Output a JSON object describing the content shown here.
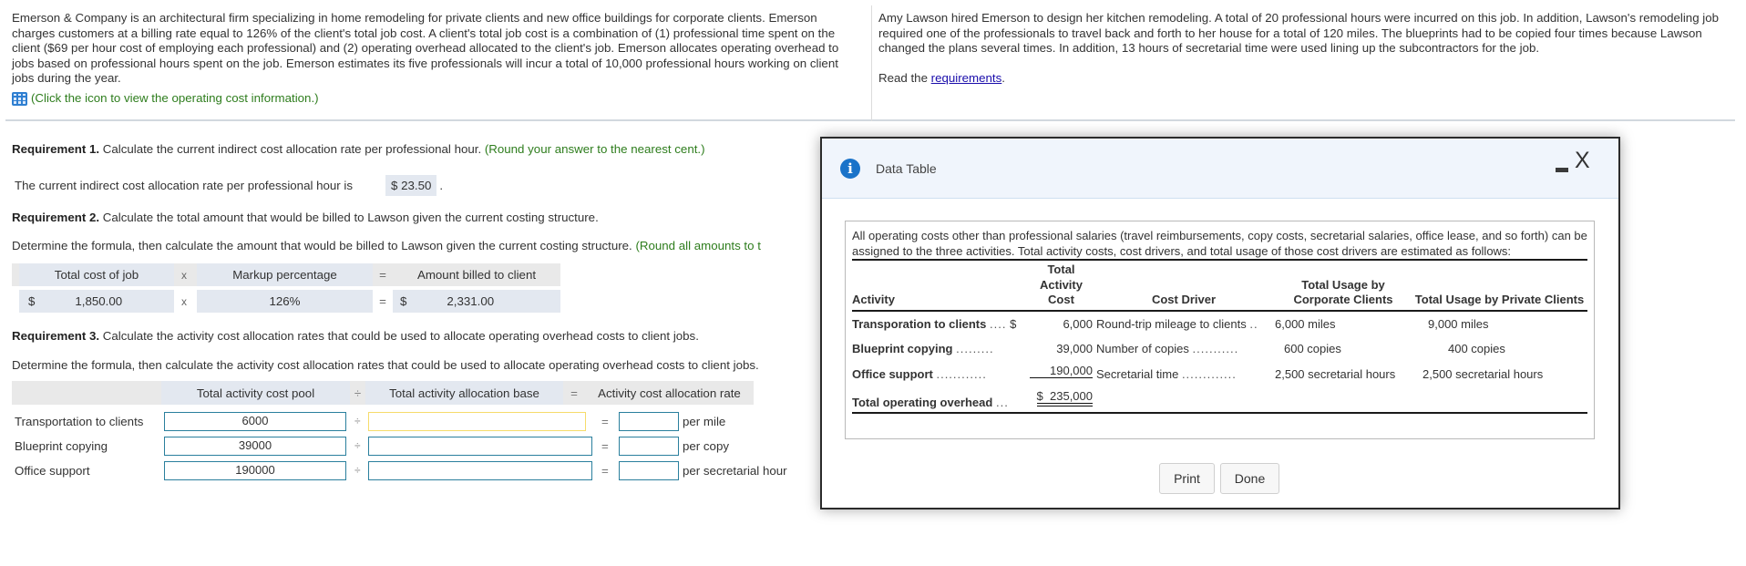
{
  "problem": {
    "intro_text": "Emerson & Company is an architectural firm specializing in home remodeling for private clients and new office buildings for corporate clients. Emerson charges customers at a billing rate equal to 126% of the client's total job cost. A client's total job cost is a combination of (1) professional time spent on the client ($69 per hour cost of employing each professional) and (2) operating overhead allocated to the client's job. Emerson allocates operating overhead to jobs based on professional hours spent on the job. Emerson estimates its five professionals will incur a total of 10,000 professional hours working on client jobs during the year.",
    "icon_link_text": "(Click the icon to view the operating cost information.)",
    "icon": "table-grid-icon",
    "lawson_text": "Amy Lawson hired Emerson to design her kitchen remodeling. A total of 20 professional hours were incurred on this job. In addition, Lawson's remodeling job required one of the professionals to travel back and forth to her house for a total of 120 miles. The blueprints had to be copied four times because Lawson changed the plans several times. In addition, 13 hours of secretarial time were used lining up the subcontractors for the job.",
    "read_prefix": "Read the ",
    "read_link": "requirements",
    "read_suffix": "."
  },
  "req1": {
    "label": "Requirement 1.",
    "text": " Calculate the current indirect cost allocation rate per professional hour. ",
    "hint": "(Round your answer to the nearest cent.)",
    "answer_prefix": "The current indirect cost allocation rate per professional hour is",
    "answer_value": "$ 23.50",
    "answer_suffix": "."
  },
  "req2": {
    "label": "Requirement 2.",
    "text": " Calculate the total amount that would be billed to Lawson given the current costing structure.",
    "determine": "Determine the formula, then calculate the amount that would be billed to Lawson given the current costing structure. ",
    "hint": "(Round all amounts to t",
    "formula": {
      "headers": [
        "Total cost of job",
        "Markup percentage",
        "Amount billed to client"
      ],
      "op1": "x",
      "op2": "=",
      "row": {
        "cost_currency": "$",
        "cost": "1,850.00",
        "markup": "126%",
        "billed_currency": "$",
        "billed": "2,331.00"
      }
    }
  },
  "req3": {
    "label": "Requirement 3.",
    "text": " Calculate the activity cost allocation rates that could be used to allocate operating overhead costs to client jobs.",
    "determine": "Determine the formula, then calculate the activity cost allocation rates that could be used to allocate operating overhead costs to client jobs.",
    "headers": [
      "Total activity cost pool",
      "Total activity allocation base",
      "Activity cost allocation rate"
    ],
    "op_div": "÷",
    "op_eq": "=",
    "rows": [
      {
        "label": "Transportation to clients",
        "pool": "6000",
        "base": "",
        "rate": "",
        "unit": "per mile"
      },
      {
        "label": "Blueprint copying",
        "pool": "39000",
        "base": "",
        "rate": "",
        "unit": "per copy"
      },
      {
        "label": "Office support",
        "pool": "190000",
        "base": "",
        "rate": "",
        "unit": "per secretarial hour"
      }
    ]
  },
  "modal": {
    "title": "Data Table",
    "minimize_label": "minimize",
    "close_label": "X",
    "intro": "All operating costs other than professional salaries (travel reimbursements, copy costs, secretarial salaries, office lease, and so forth) can be assigned to the three activities. Total activity costs, cost drivers, and total usage of those cost drivers are estimated as follows:",
    "columns": [
      "Activity",
      "Total Activity Cost",
      "Cost Driver",
      "Total Usage by Corporate Clients",
      "Total Usage by Private Clients"
    ],
    "rows": [
      {
        "activity": "Transporation to clients",
        "dots": "....",
        "currency": "$",
        "cost": "6,000",
        "driver": "Round-trip mileage to clients",
        "driver_dots": "..",
        "corporate": "6,000 miles",
        "private": "9,000 miles"
      },
      {
        "activity": "Blueprint copying",
        "dots": ".........",
        "currency": "",
        "cost": "39,000",
        "driver": "Number of copies",
        "driver_dots": "...........",
        "corporate": "600 copies",
        "private": "400 copies"
      },
      {
        "activity": "Office support",
        "dots": "............",
        "currency": "",
        "cost": "190,000",
        "driver": "Secretarial time",
        "driver_dots": ".............",
        "corporate": "2,500 secretarial hours",
        "private": "2,500 secretarial hours"
      }
    ],
    "total": {
      "label": "Total operating overhead",
      "dots": "...",
      "currency": "$",
      "value": "235,000"
    },
    "print_label": "Print",
    "done_label": "Done"
  }
}
